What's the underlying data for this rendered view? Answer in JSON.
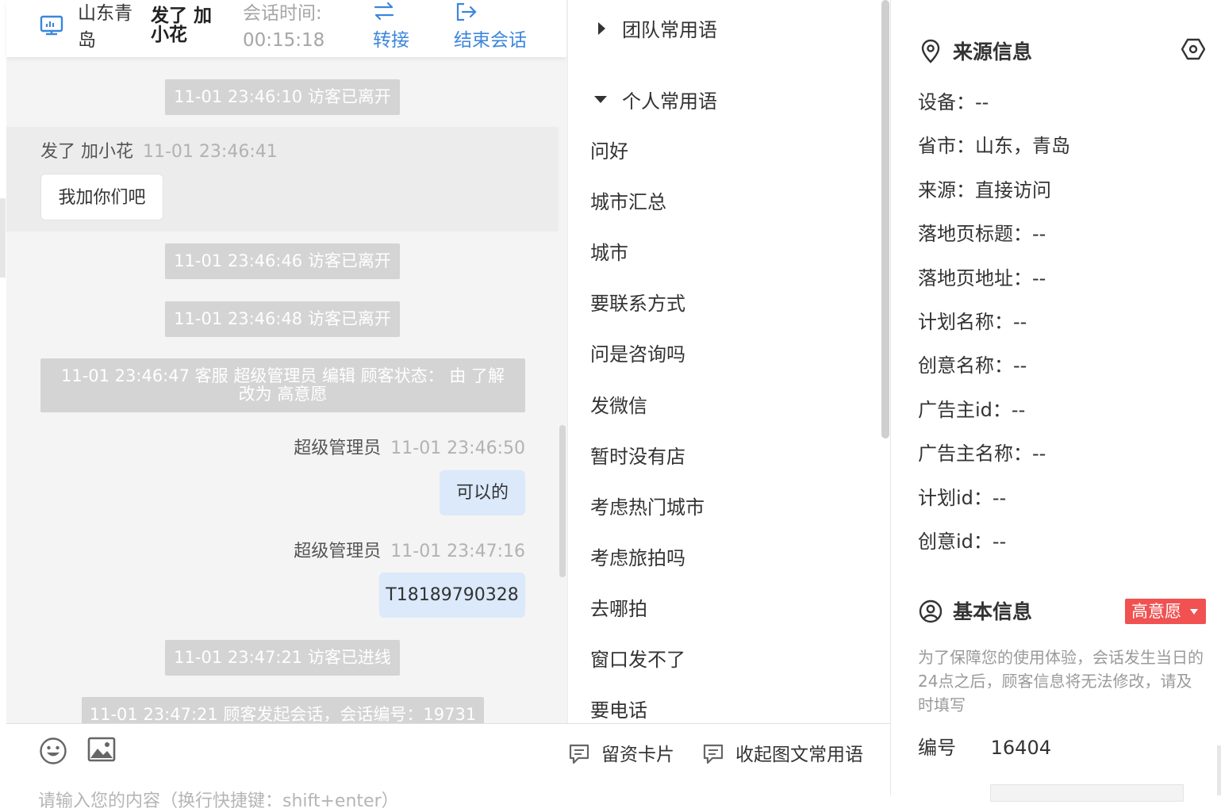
{
  "header": {
    "visitor_location": "山东青岛",
    "visitor_location_l1": "山东青",
    "visitor_location_l2": "岛",
    "visitor_name_l1": "发了 加",
    "visitor_name_l2": "小花",
    "session_time_label": "会话时间:",
    "session_time_value": "00:15:18",
    "transfer_label": "转接",
    "end_session_label": "结束会话"
  },
  "chat": {
    "messages": [
      {
        "kind": "system",
        "text": "11-01 23:46:10 访客已离开"
      },
      {
        "kind": "visitor",
        "sender": "发了 加小花",
        "time": "11-01 23:46:41",
        "text": "我加你们吧"
      },
      {
        "kind": "system",
        "text": "11-01 23:46:46 访客已离开"
      },
      {
        "kind": "system",
        "text": "11-01 23:46:48 访客已离开"
      },
      {
        "kind": "system",
        "text_l1": "11-01 23:46:47 客服 超级管理员 编辑 顾客状态： 由 了解",
        "text_l2": "改为 高意愿"
      },
      {
        "kind": "agent",
        "sender": "超级管理员",
        "time": "11-01 23:46:50",
        "text": "可以的"
      },
      {
        "kind": "agent",
        "sender": "超级管理员",
        "time": "11-01 23:47:16",
        "text": "T18189790328"
      },
      {
        "kind": "system",
        "text": "11-01 23:47:21 访客已进线"
      },
      {
        "kind": "system",
        "text": "11-01 23:47:21 顾客发起会话，会话编号：19731"
      }
    ]
  },
  "composer": {
    "emoji_icon": "emoji-icon",
    "image_icon": "image-icon",
    "lead_card_label": "留资卡片",
    "collapse_phrases_label": "收起图文常用语",
    "placeholder": "请输入您的内容（换行快捷键：shift+enter）"
  },
  "phrases": {
    "team_group_label": "团队常用语",
    "personal_group_label": "个人常用语",
    "items": [
      "问好",
      "城市汇总",
      "城市",
      "要联系方式",
      "问是咨询吗",
      "发微信",
      "暂时没有店",
      "考虑热门城市",
      "考虑旅拍吗",
      "去哪拍",
      "窗口发不了",
      "要电话"
    ]
  },
  "source_info": {
    "title": "来源信息",
    "rows": [
      {
        "label": "设备：",
        "value": "--"
      },
      {
        "label": "省市：",
        "value": "山东，青岛"
      },
      {
        "label": "来源：",
        "value": "直接访问"
      },
      {
        "label": "落地页标题：",
        "value": "--"
      },
      {
        "label": "落地页地址：",
        "value": "--"
      },
      {
        "label": "计划名称：",
        "value": "--"
      },
      {
        "label": "创意名称：",
        "value": "--"
      },
      {
        "label": "广告主id：",
        "value": "--"
      },
      {
        "label": "广告主名称：",
        "value": "--"
      },
      {
        "label": "计划id：",
        "value": "--"
      },
      {
        "label": "创意id：",
        "value": "--"
      }
    ]
  },
  "basic_info": {
    "title": "基本信息",
    "intent_badge": "高意愿",
    "notice": "为了保障您的使用体验，会话发生当日的24点之后，顾客信息将无法修改，请及时填写",
    "id_label": "编号",
    "id_value": "16404"
  },
  "colors": {
    "accent_blue": "#3b86db",
    "badge_red": "#f15151",
    "agent_bubble": "#dbe9fb",
    "system_msg": "#d4d4d4"
  }
}
